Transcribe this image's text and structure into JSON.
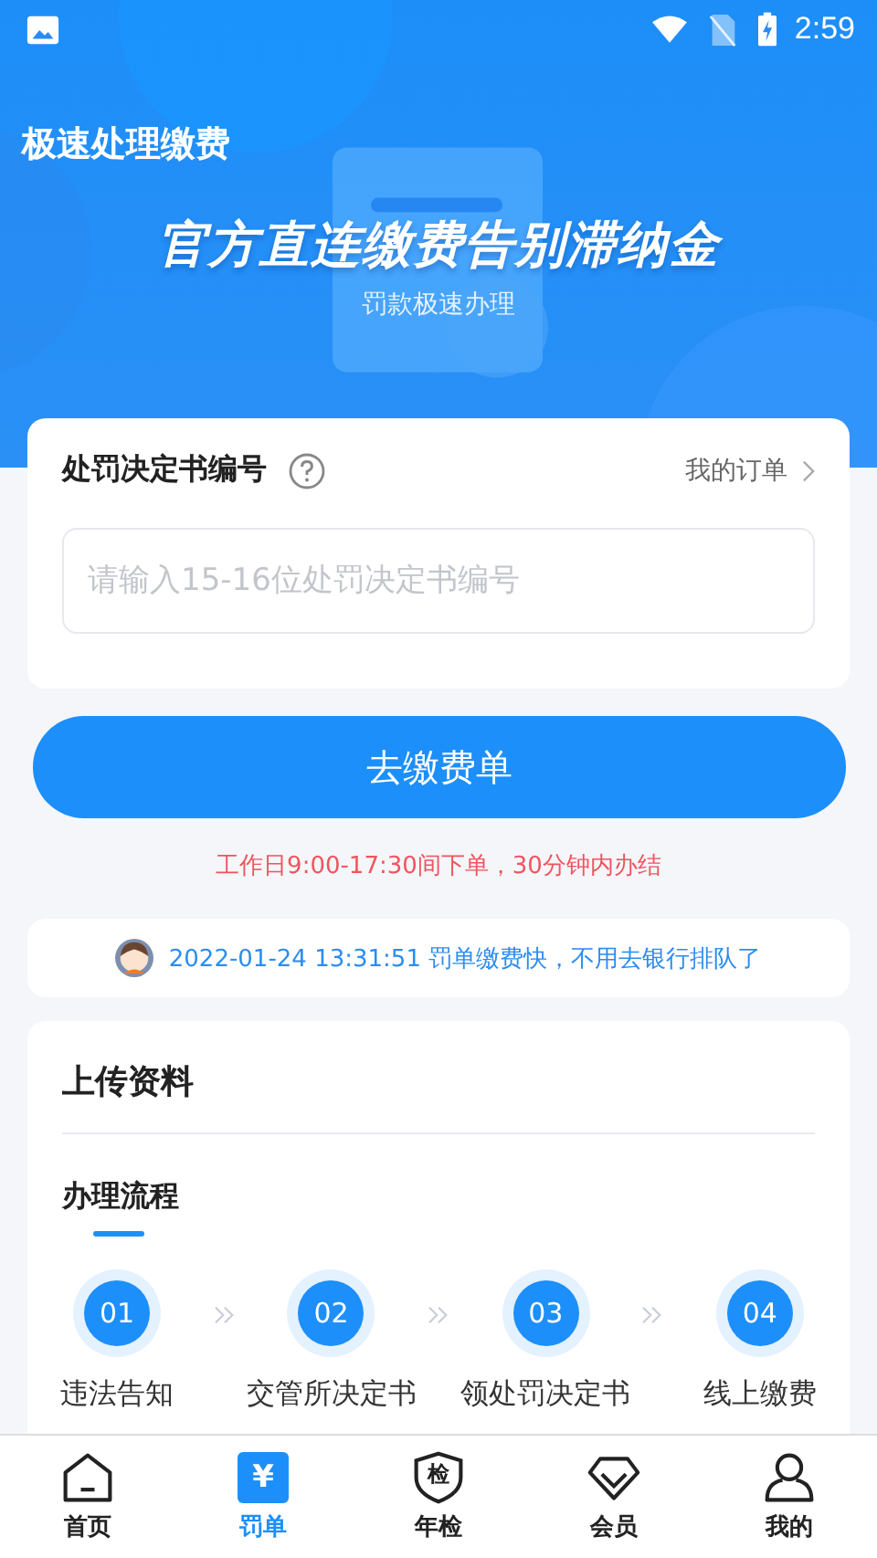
{
  "status_bar": {
    "time": "2:59"
  },
  "banner": {
    "title": "极速处理缴费",
    "slogan": "官方直连缴费告别滞纳金",
    "subtitle": "罚款极速办理"
  },
  "query_card": {
    "label": "处罚决定书编号",
    "order_link": "我的订单",
    "input": {
      "placeholder": "请输入15-16位处罚决定书编号"
    }
  },
  "submit_button": "去缴费单",
  "notice": "工作日9:00-17:30间下单，30分钟内办结",
  "ticker": {
    "text": "2022-01-24 13:31:51 罚单缴费快，不用去银行排队了"
  },
  "upload_card": {
    "title": "上传资料",
    "section": "办理流程",
    "steps": [
      {
        "number": "01",
        "label": "违法告知"
      },
      {
        "number": "02",
        "label": "交管所决定书"
      },
      {
        "number": "03",
        "label": "领处罚决定书"
      },
      {
        "number": "04",
        "label": "线上缴费"
      }
    ]
  },
  "bottom_nav": [
    {
      "kind": "home",
      "label": "首页",
      "selected": false
    },
    {
      "kind": "fine",
      "glyph": "¥",
      "label": "罚单",
      "selected": true
    },
    {
      "kind": "inspect",
      "glyph": "检",
      "label": "年检",
      "selected": false
    },
    {
      "kind": "member",
      "label": "会员",
      "selected": false
    },
    {
      "kind": "me",
      "label": "我的",
      "selected": false
    }
  ]
}
